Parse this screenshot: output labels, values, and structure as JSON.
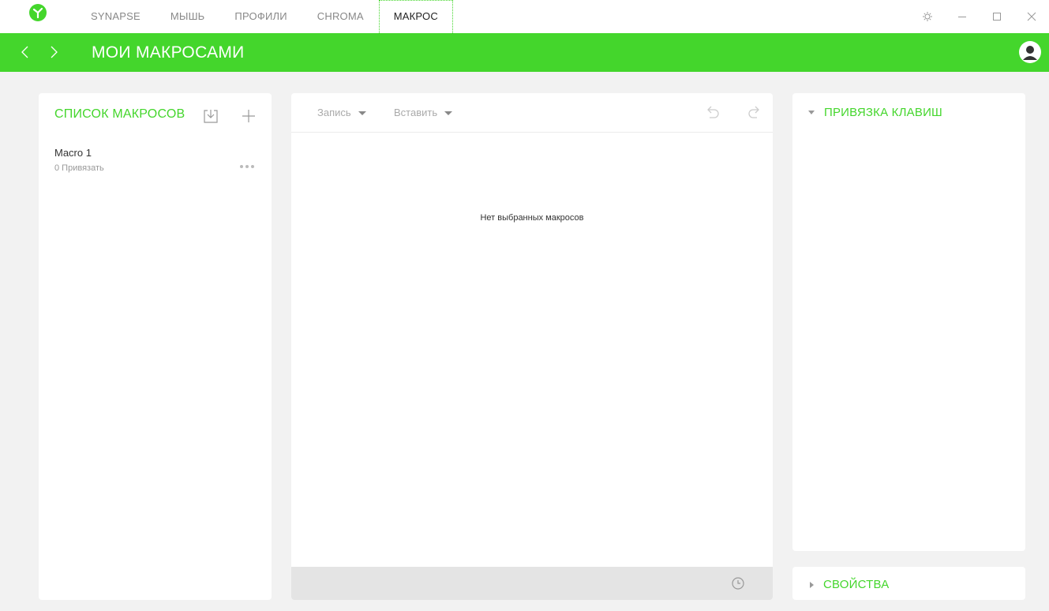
{
  "titlebar": {
    "tabs": [
      {
        "label": "SYNAPSE"
      },
      {
        "label": "МЫШЬ"
      },
      {
        "label": "ПРОФИЛИ"
      },
      {
        "label": "CHROMA"
      },
      {
        "label": "МАКРОС",
        "active": true
      }
    ],
    "icons": {
      "logo": "razer-logo-icon",
      "settings": "gear-icon",
      "minimize": "minimize-icon",
      "maximize": "maximize-icon",
      "close": "close-icon"
    }
  },
  "header": {
    "title": "МОИ МАКРОСАМИ",
    "icons": {
      "back": "chevron-left-icon",
      "forward": "chevron-right-icon",
      "avatar": "user-avatar-icon"
    }
  },
  "macro_list": {
    "title": "СПИСОК МАКРОСОВ",
    "icons": {
      "import": "import-icon",
      "add": "plus-icon",
      "more": "more-options-icon"
    },
    "items": [
      {
        "name": "Macro 1",
        "subtitle": "0 Привязать"
      }
    ]
  },
  "editor": {
    "record_label": "Запись",
    "insert_label": "Вставить",
    "empty_message": "Нет выбранных макросов",
    "icons": {
      "undo": "undo-icon",
      "redo": "redo-icon",
      "delay": "clock-icon"
    }
  },
  "key_binding": {
    "title": "ПРИВЯЗКА КЛАВИШ"
  },
  "properties": {
    "title": "СВОЙСТВА"
  },
  "colors": {
    "accent": "#44d62c",
    "background": "#f2f2f2",
    "panel": "#ffffff"
  }
}
